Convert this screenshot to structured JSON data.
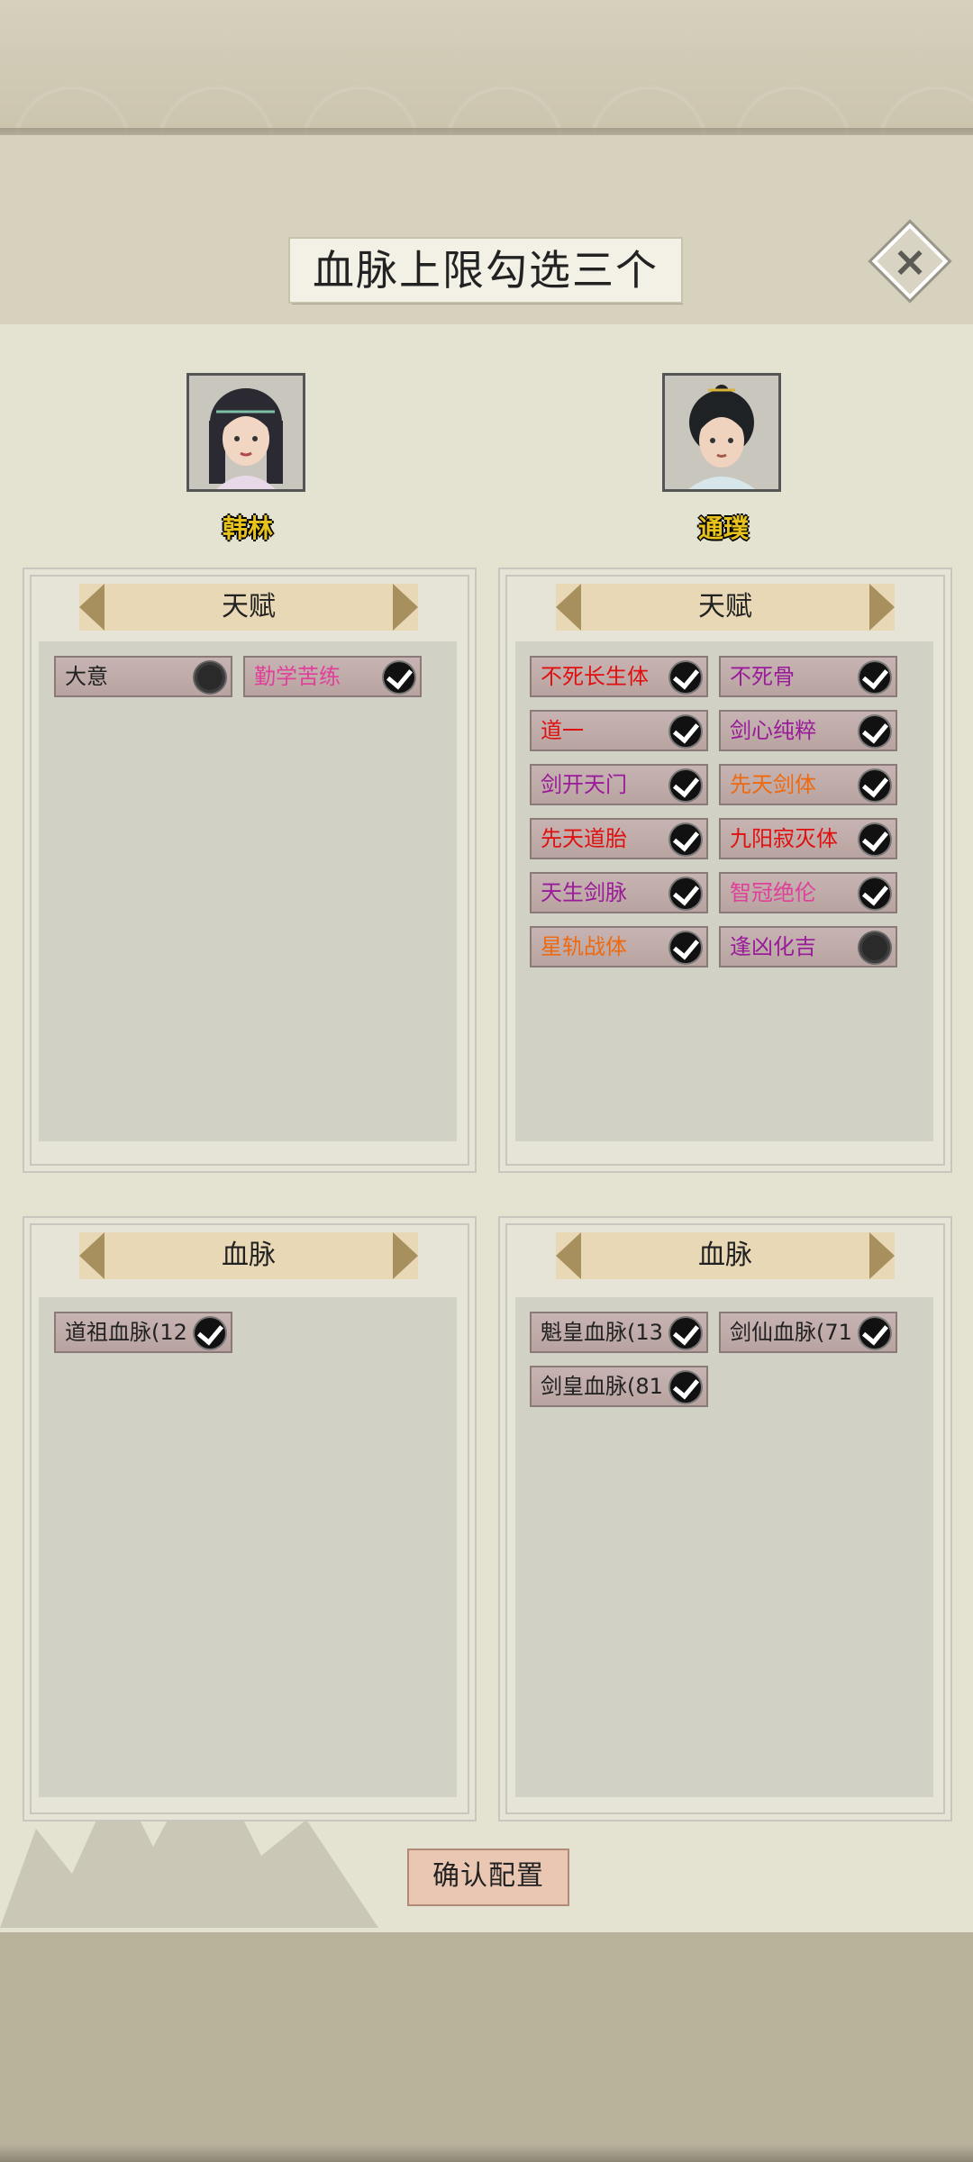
{
  "title": "血脉上限勾选三个",
  "confirm_label": "确认配置",
  "characters": [
    {
      "name": "韩林",
      "talent_header": "天赋",
      "talents": [
        {
          "label": "大意",
          "color": "#222222",
          "checked": false
        },
        {
          "label": "勤学苦练",
          "color": "#e0409a",
          "checked": true
        }
      ],
      "bloodline_header": "血脉",
      "bloodlines": [
        {
          "label": "道祖血脉(12",
          "color": "#222222",
          "checked": true
        }
      ]
    },
    {
      "name": "通璞",
      "talent_header": "天赋",
      "talents": [
        {
          "label": "不死长生体",
          "color": "#e01010",
          "checked": true
        },
        {
          "label": "不死骨",
          "color": "#9a1b9a",
          "checked": true
        },
        {
          "label": "道一",
          "color": "#e01010",
          "checked": true
        },
        {
          "label": "剑心纯粹",
          "color": "#9a1b9a",
          "checked": true
        },
        {
          "label": "剑开天门",
          "color": "#9a1b9a",
          "checked": true
        },
        {
          "label": "先天剑体",
          "color": "#ee6a10",
          "checked": true
        },
        {
          "label": "先天道胎",
          "color": "#e01010",
          "checked": true
        },
        {
          "label": "九阳寂灭体",
          "color": "#e01010",
          "checked": true
        },
        {
          "label": "天生剑脉",
          "color": "#9a1b9a",
          "checked": true
        },
        {
          "label": "智冠绝伦",
          "color": "#e0409a",
          "checked": true
        },
        {
          "label": "星轨战体",
          "color": "#ee6a10",
          "checked": true
        },
        {
          "label": "逢凶化吉",
          "color": "#9a1b9a",
          "checked": false
        }
      ],
      "bloodline_header": "血脉",
      "bloodlines": [
        {
          "label": "魁皇血脉(13",
          "color": "#222222",
          "checked": true
        },
        {
          "label": "剑仙血脉(71",
          "color": "#222222",
          "checked": true
        },
        {
          "label": "剑皇血脉(81",
          "color": "#222222",
          "checked": true
        }
      ]
    }
  ]
}
